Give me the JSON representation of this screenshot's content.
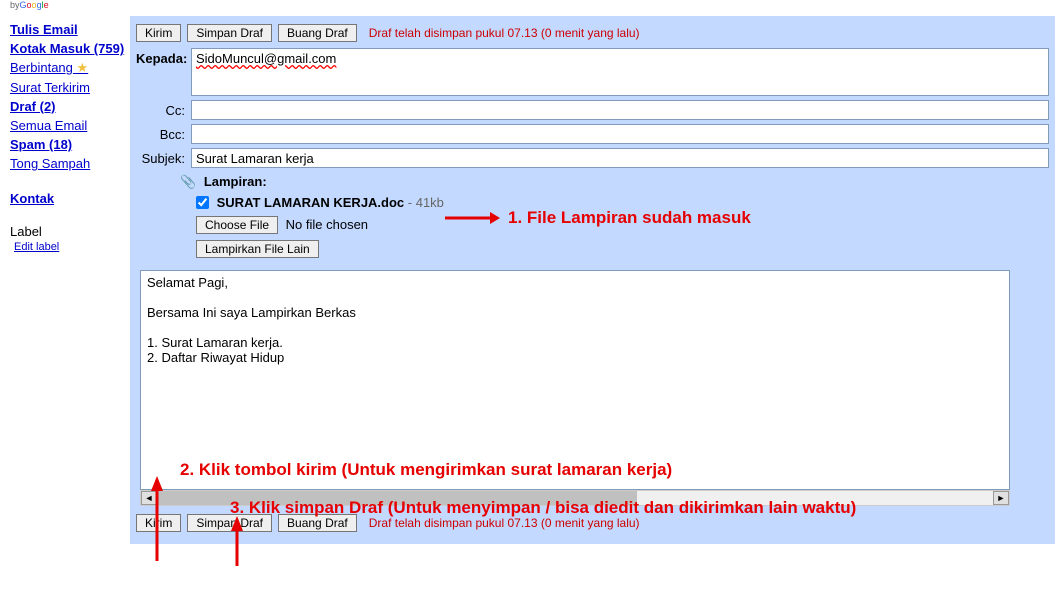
{
  "logo_prefix": "by",
  "sidebar": {
    "compose": "Tulis Email",
    "inbox": "Kotak Masuk (759)",
    "starred": "Berbintang",
    "sent": "Surat Terkirim",
    "drafts": "Draf (2)",
    "all": "Semua Email",
    "spam": "Spam (18)",
    "trash": "Tong Sampah",
    "contacts": "Kontak",
    "label_hdr": "Label",
    "edit_label": "Edit label"
  },
  "toolbar": {
    "send": "Kirim",
    "save": "Simpan Draf",
    "discard": "Buang Draf",
    "status": "Draf telah disimpan pukul 07.13 (0 menit yang lalu)"
  },
  "labels": {
    "to": "Kepada:",
    "cc": "Cc:",
    "bcc": "Bcc:",
    "subject": "Subjek:",
    "attach": "Lampiran:",
    "choose": "Choose File",
    "nofile": "No file chosen",
    "more_attach": "Lampirkan File Lain"
  },
  "fields": {
    "to": "SidoMuncul@gmail.com",
    "cc": "",
    "bcc": "",
    "subject": "Surat Lamaran kerja"
  },
  "attachment": {
    "name": "SURAT LAMARAN KERJA.doc",
    "size": " - 41kb"
  },
  "body": "Selamat Pagi,\n\nBersama Ini saya Lampirkan Berkas\n\n1. Surat Lamaran kerja.\n2. Daftar Riwayat Hidup",
  "annotations": {
    "a1": "1. File Lampiran sudah masuk",
    "a2": "2. Klik tombol kirim (Untuk mengirimkan surat lamaran kerja)",
    "a3": "3. Klik simpan Draf (Untuk menyimpan / bisa diedit dan dikirimkan lain waktu)"
  }
}
